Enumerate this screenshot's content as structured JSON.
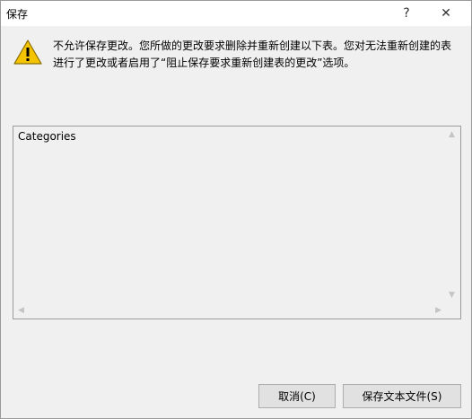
{
  "window": {
    "title": "保存",
    "help_label": "?",
    "close_label": "✕"
  },
  "message": "不允许保存更改。您所做的更改要求删除并重新创建以下表。您对无法重新创建的表进行了更改或者启用了“阻止保存要求重新创建表的更改”选项。",
  "list": {
    "items": [
      "Categories"
    ]
  },
  "buttons": {
    "cancel": "取消(C)",
    "save_text": "保存文本文件(S)"
  },
  "icons": {
    "warning": "warning-icon",
    "scroll_up": "chevron-up-icon",
    "scroll_down": "chevron-down-icon",
    "scroll_left": "chevron-left-icon",
    "scroll_right": "chevron-right-icon"
  },
  "colors": {
    "background": "#f0f0f0",
    "warning_fill": "#f5c400"
  }
}
